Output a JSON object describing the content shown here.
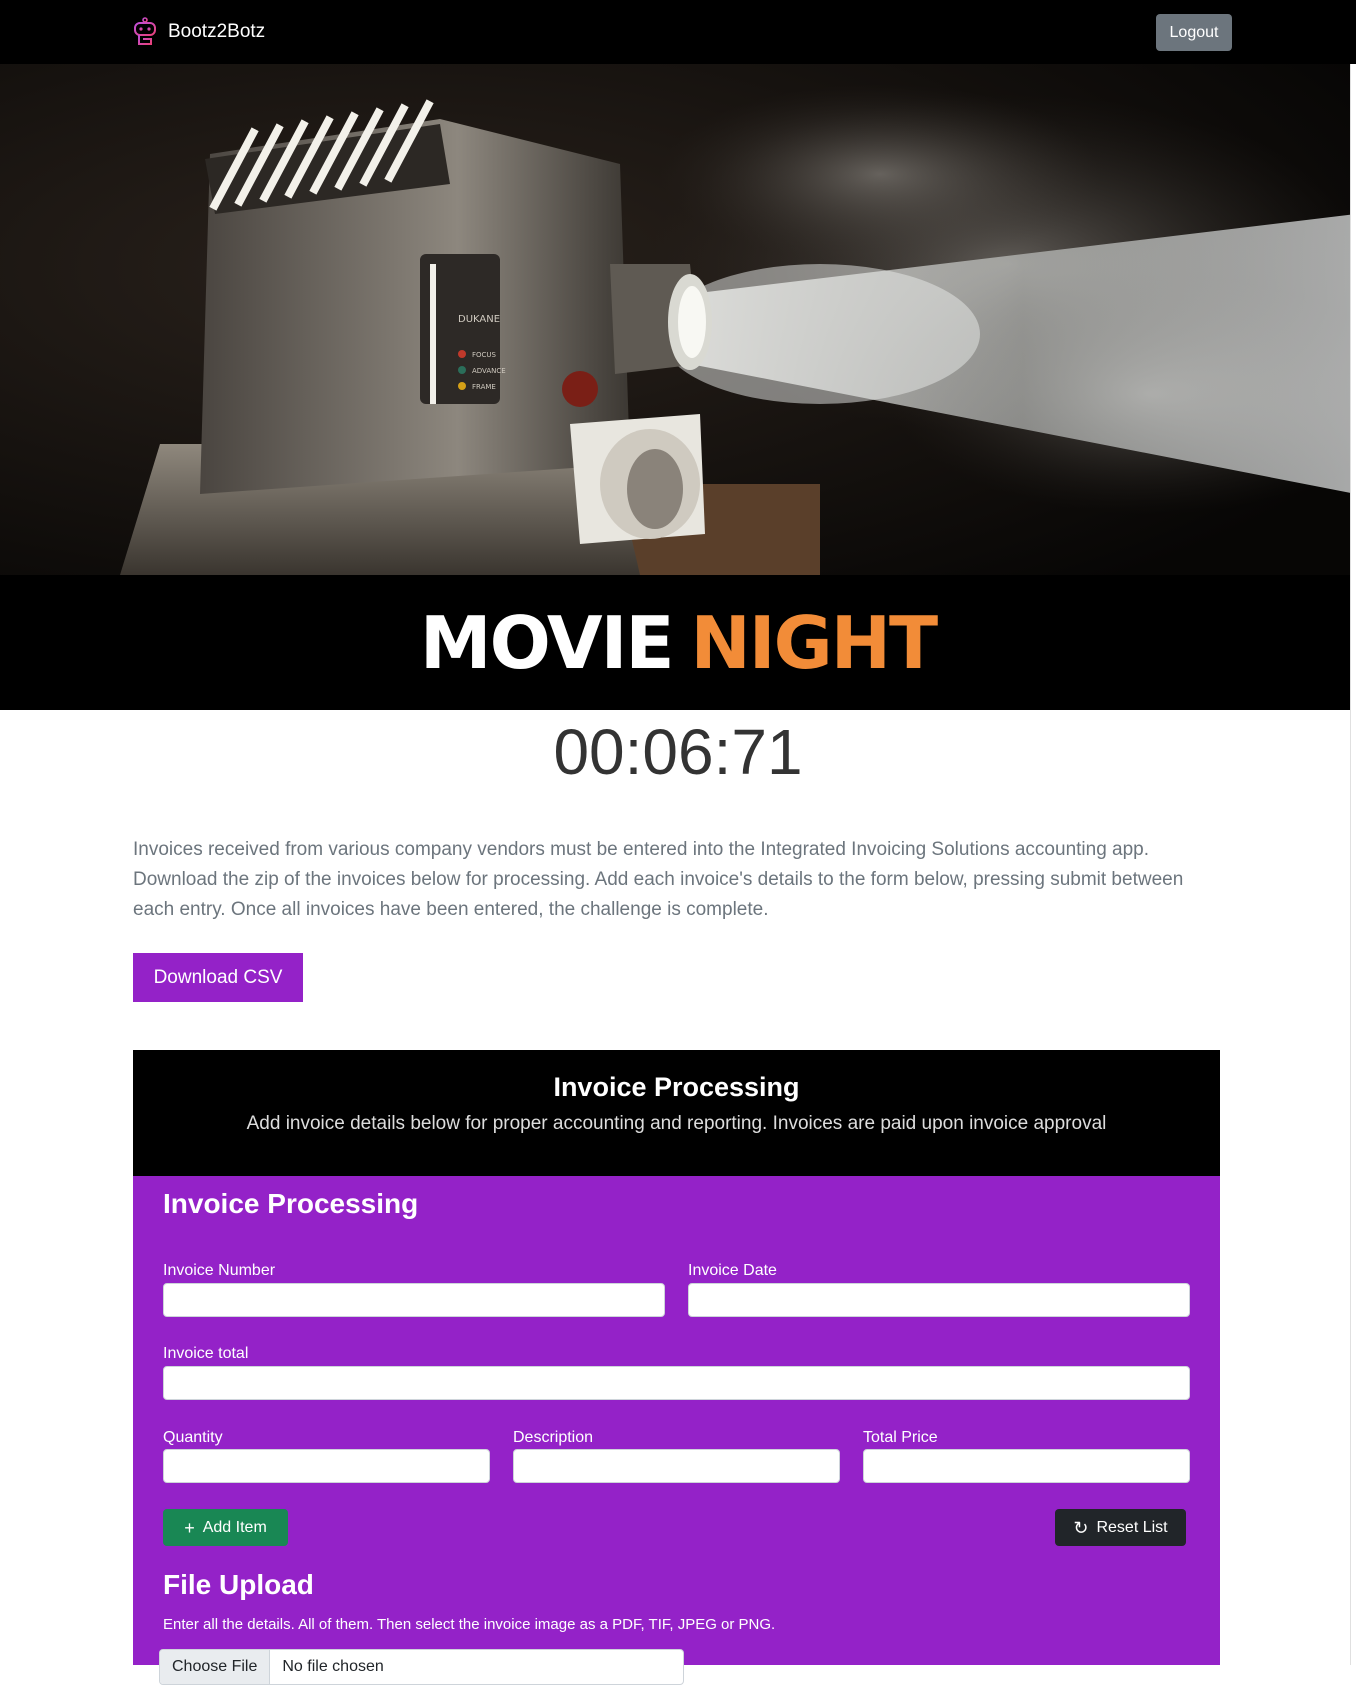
{
  "navbar": {
    "brand": "Bootz2Botz",
    "logout_label": "Logout"
  },
  "hero": {
    "title_part1": "MOVIE",
    "title_part2": "NIGHT",
    "projector_brand": "DUKANE",
    "projector_labels": [
      "FOCUS",
      "ADVANCE",
      "FRAME"
    ]
  },
  "timer": "00:06:71",
  "intro_text": "Invoices received from various company vendors must be entered into the Integrated Invoicing Solutions accounting app. Download the zip of the invoices below for processing. Add each invoice's details to the form below, pressing submit between each entry. Once all invoices have been entered, the challenge is complete.",
  "download_label": "Download CSV",
  "invoice_card": {
    "header_title": "Invoice Processing",
    "header_subtitle": "Add invoice details below for proper accounting and reporting. Invoices are paid upon invoice approval",
    "form_title": "Invoice Processing",
    "fields": {
      "invoice_number": {
        "label": "Invoice Number",
        "value": ""
      },
      "invoice_date": {
        "label": "Invoice Date",
        "value": ""
      },
      "invoice_total": {
        "label": "Invoice total",
        "value": ""
      },
      "quantity": {
        "label": "Quantity",
        "value": ""
      },
      "description": {
        "label": "Description",
        "value": ""
      },
      "total_price": {
        "label": "Total Price",
        "value": ""
      }
    },
    "add_item_label": "Add Item",
    "reset_list_label": "Reset List",
    "upload_title": "File Upload",
    "upload_help": "Enter all the details. All of them. Then select the invoice image as a PDF, TIF, JPEG or PNG.",
    "choose_file_label": "Choose File",
    "file_name": "No file chosen"
  },
  "colors": {
    "accent_purple": "#9422c8",
    "title_orange": "#f28c38",
    "add_green": "#198754",
    "reset_dark": "#212529",
    "logout_gray": "#6c757d"
  }
}
